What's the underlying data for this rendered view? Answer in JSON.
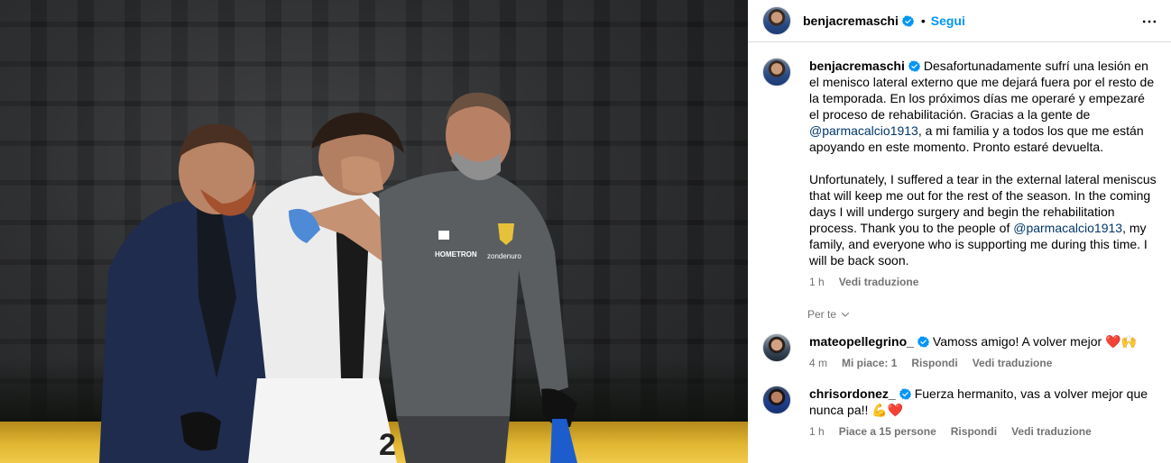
{
  "post": {
    "author": "benjacremaschi",
    "dot": "•",
    "follow_label": "Segui",
    "caption_es": "Desafortunadamente sufrí una lesión en el menisco lateral externo que me dejará fuera por el resto de la temporada. En los próximos días me operaré y empezaré el proceso de rehabilitación. Gracias a la gente de ",
    "mention_1": "@parmacalcio1913",
    "caption_es_end": ", a mi familia y a todos los que me están apoyando en este momento. Pronto estaré devuelta.",
    "caption_en": "Unfortunately, I suffered a tear in the external lateral meniscus that will keep me out for the rest of the season. In the coming days I will undergo surgery and begin the rehabilitation process. Thank you to the people of ",
    "mention_2": "@parmacalcio1913",
    "caption_en_end": ", my family, and everyone who is supporting me during this time. I will be back soon.",
    "time": "1 h",
    "translate_label": "Vedi traduzione"
  },
  "filter": {
    "label": "Per te"
  },
  "comments": [
    {
      "user": "mateopellegrino_",
      "text": "Vamoss amigo! A volver mejor ",
      "emoji": "❤️🙌",
      "time": "4 m",
      "likes": "Mi piace: 1",
      "reply": "Rispondi",
      "translate": "Vedi traduzione"
    },
    {
      "user": "chrisordonez_",
      "text": "Fuerza hermanito, vas a volver mejor que nunca pa!! ",
      "emoji": "💪❤️",
      "time": "1 h",
      "likes": "Piace a 15 persone",
      "reply": "Rispondi",
      "translate": "Vedi traduzione"
    }
  ],
  "photo": {
    "jersey_number": "2",
    "sponsor_1": "HOMETRON",
    "sponsor_2": "zondenuro"
  },
  "colors": {
    "accent": "#0095f6",
    "mention": "#00376b",
    "muted": "#737373",
    "verified": "#0095f6"
  }
}
